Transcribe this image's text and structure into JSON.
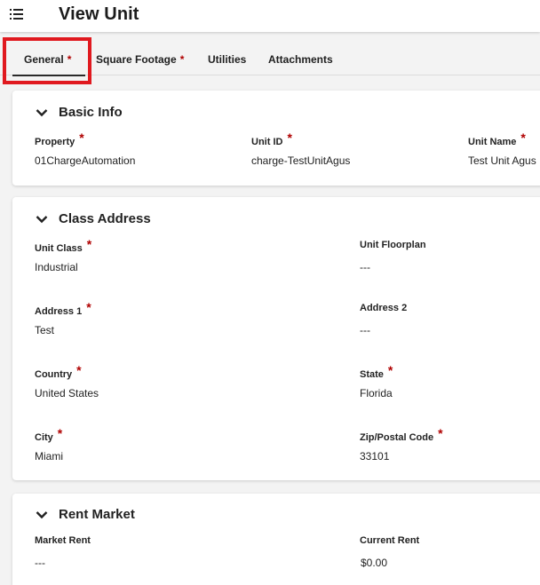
{
  "header": {
    "title": "View Unit",
    "menu_icon": "hamburger-menu-icon"
  },
  "tabs": [
    {
      "label": "General",
      "required": "*",
      "active": true
    },
    {
      "label": "Square Footage",
      "required": "*"
    },
    {
      "label": "Utilities"
    },
    {
      "label": "Attachments"
    }
  ],
  "colors": {
    "required_star": "#b00000",
    "highlight_box": "#e0191f"
  },
  "basic_info": {
    "title": "Basic Info",
    "fields": [
      {
        "label": "Property",
        "required": "*",
        "value": "01ChargeAutomation"
      },
      {
        "label": "Unit ID",
        "required": "*",
        "value": "charge-TestUnitAgus"
      },
      {
        "label": "Unit Name",
        "required": "*",
        "value": "Test Unit Agus"
      }
    ]
  },
  "class_address": {
    "title": "Class Address",
    "fields": [
      {
        "label": "Unit Class",
        "required": "*",
        "value": "Industrial"
      },
      {
        "label": "Unit Floorplan",
        "value": "---"
      },
      {
        "label": "Address 1",
        "required": "*",
        "value": "Test"
      },
      {
        "label": "Address 2",
        "value": "---"
      },
      {
        "label": "Country",
        "required": "*",
        "value": "United States"
      },
      {
        "label": "State",
        "required": "*",
        "value": "Florida"
      },
      {
        "label": "City",
        "required": "*",
        "value": "Miami"
      },
      {
        "label": "Zip/Postal Code",
        "required": "*",
        "value": "33101"
      }
    ]
  },
  "rent_market": {
    "title": "Rent Market",
    "fields": [
      {
        "label": "Market Rent",
        "value": "---"
      },
      {
        "label": "Current Rent",
        "value": "$0.00"
      }
    ]
  }
}
